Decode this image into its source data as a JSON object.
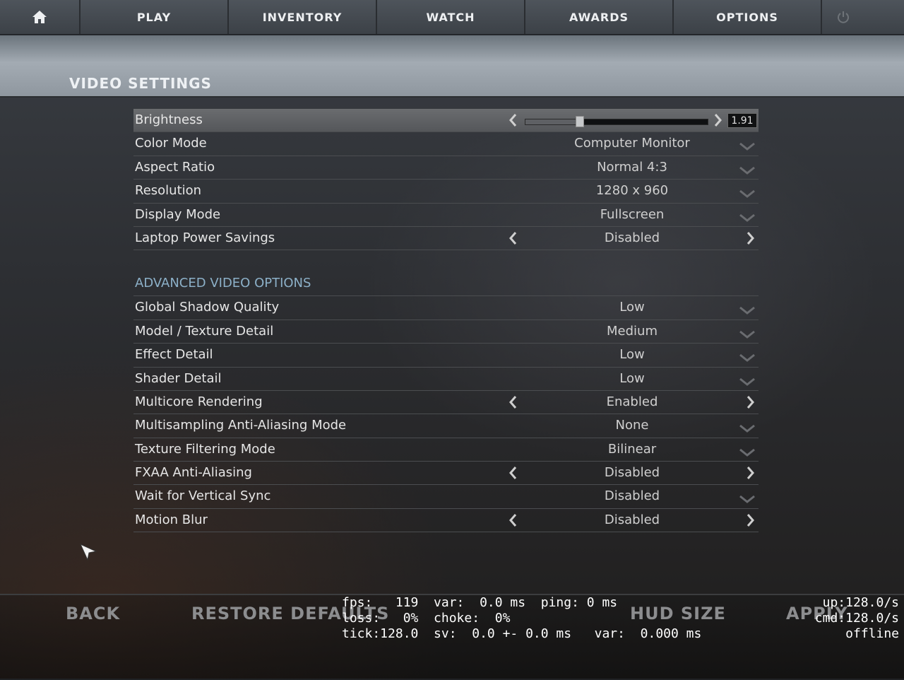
{
  "nav": {
    "tabs": [
      "PLAY",
      "INVENTORY",
      "WATCH",
      "AWARDS",
      "OPTIONS"
    ],
    "icons": [
      "home-icon",
      "power-icon"
    ]
  },
  "page_title": "VIDEO SETTINGS",
  "brightness": {
    "label": "Brightness",
    "value": "1.91",
    "level": 0.3
  },
  "basic": [
    {
      "label": "Color Mode",
      "value": "Computer Monitor",
      "control": "dropdown"
    },
    {
      "label": "Aspect Ratio",
      "value": "Normal 4:3",
      "control": "dropdown"
    },
    {
      "label": "Resolution",
      "value": "1280 x 960",
      "control": "dropdown"
    },
    {
      "label": "Display Mode",
      "value": "Fullscreen",
      "control": "dropdown"
    },
    {
      "label": "Laptop Power Savings",
      "value": "Disabled",
      "control": "toggle"
    }
  ],
  "advanced_title": "ADVANCED VIDEO OPTIONS",
  "advanced": [
    {
      "label": "Global Shadow Quality",
      "value": "Low",
      "control": "dropdown"
    },
    {
      "label": "Model / Texture Detail",
      "value": "Medium",
      "control": "dropdown"
    },
    {
      "label": "Effect Detail",
      "value": "Low",
      "control": "dropdown"
    },
    {
      "label": "Shader Detail",
      "value": "Low",
      "control": "dropdown"
    },
    {
      "label": "Multicore Rendering",
      "value": "Enabled",
      "control": "toggle"
    },
    {
      "label": "Multisampling Anti-Aliasing Mode",
      "value": "None",
      "control": "dropdown"
    },
    {
      "label": "Texture Filtering Mode",
      "value": "Bilinear",
      "control": "dropdown"
    },
    {
      "label": "FXAA Anti-Aliasing",
      "value": "Disabled",
      "control": "toggle"
    },
    {
      "label": "Wait for Vertical Sync",
      "value": "Disabled",
      "control": "dropdown"
    },
    {
      "label": "Motion Blur",
      "value": "Disabled",
      "control": "toggle"
    }
  ],
  "bottom": {
    "back": "BACK",
    "restore": "RESTORE DEFAULTS",
    "hud_size": "HUD SIZE",
    "apply": "APPLY"
  },
  "netgraph": {
    "line1": "fps:   119  var:  0.0 ms  ping: 0 ms",
    "line2": "loss:   0%  choke:  0%",
    "line3": "tick:128.0  sv:  0.0 +- 0.0 ms   var:  0.000 ms",
    "right1": "up:128.0/s",
    "right2": "cmd:128.0/s",
    "right3": "offline"
  },
  "colors": {
    "accent": "#8cb0c8",
    "highlight": "#606265"
  }
}
